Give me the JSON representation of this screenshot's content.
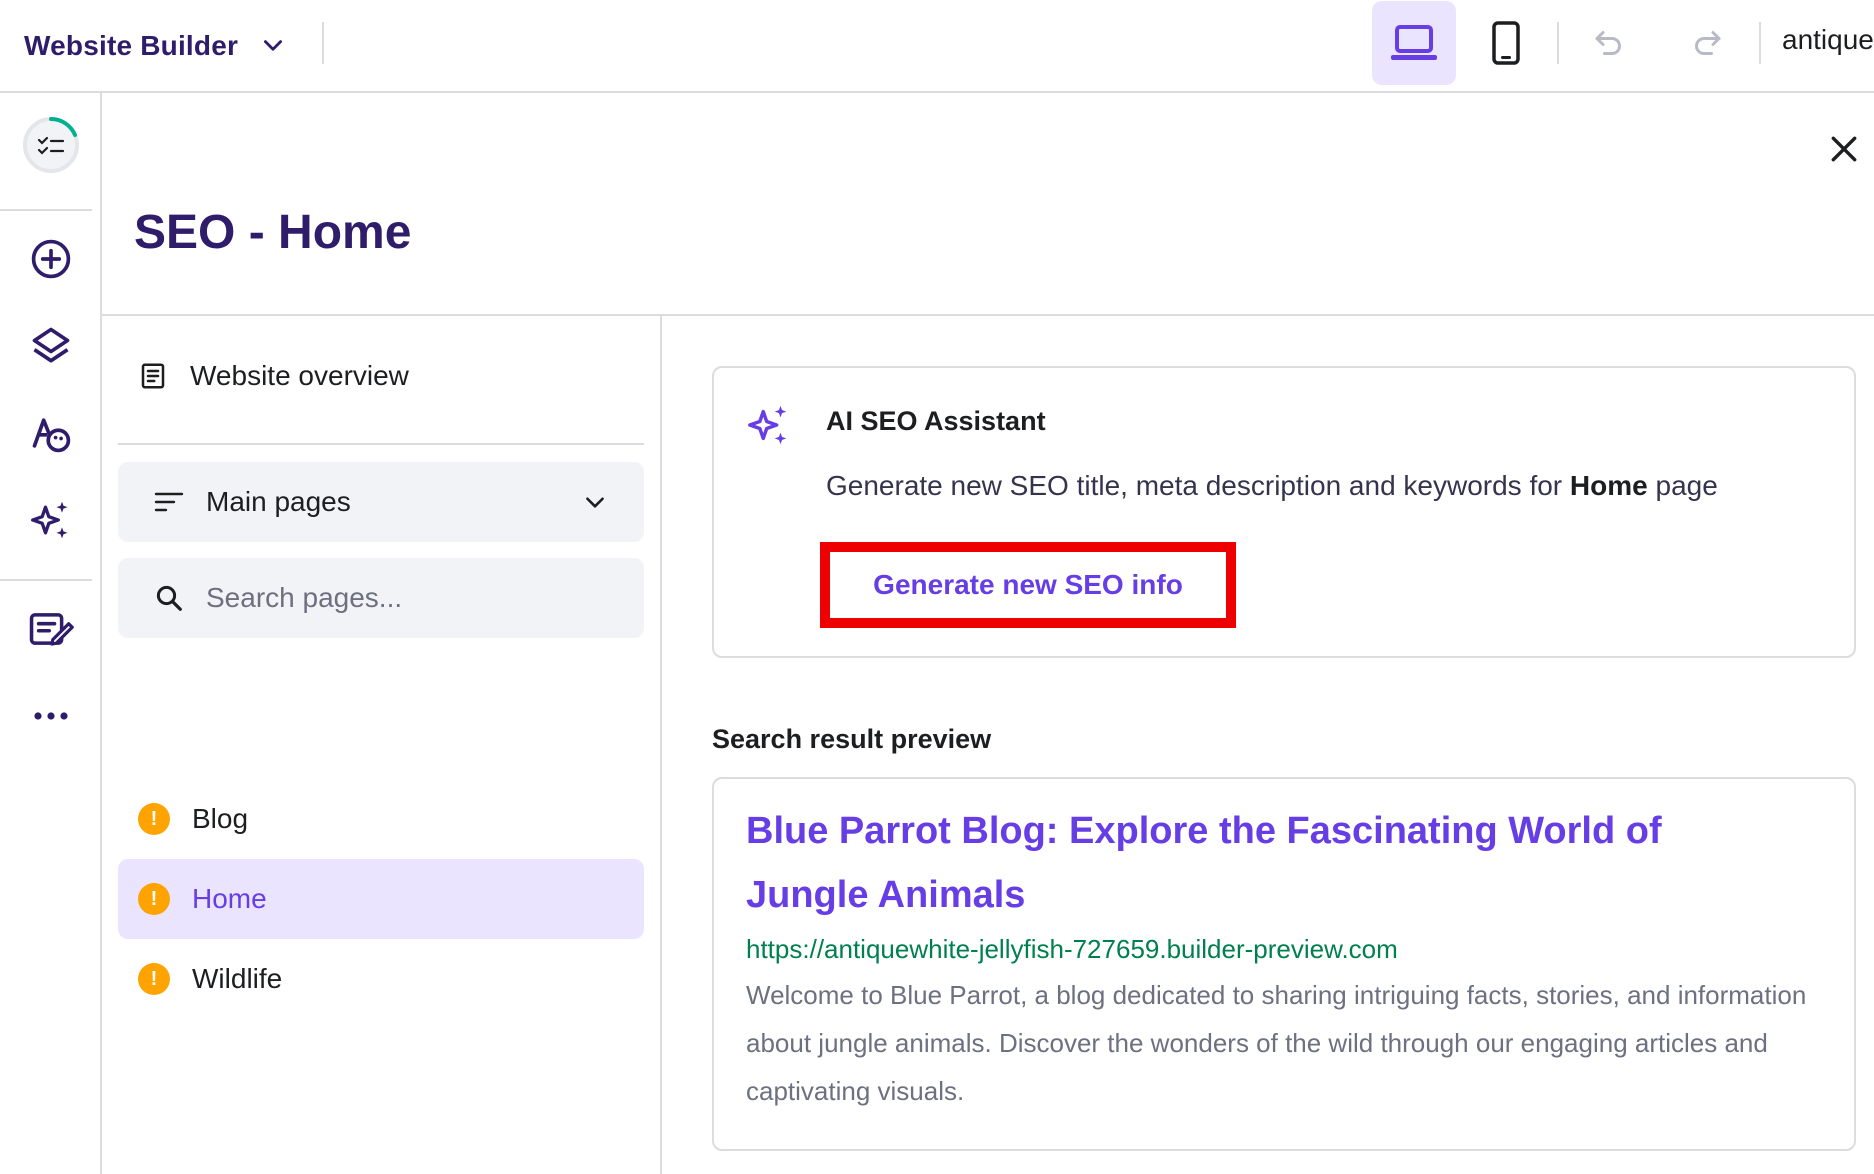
{
  "topbar": {
    "brand_label": "Website Builder",
    "domain_text": "antique",
    "icons": {
      "brand_dropdown": "chevron-down-icon",
      "desktop": "laptop-icon",
      "mobile": "mobile-icon",
      "undo": "undo-icon",
      "redo": "redo-icon"
    },
    "active_device": "desktop"
  },
  "rail": {
    "items": [
      {
        "icon": "checklist-progress-icon"
      },
      {
        "icon": "add-circle-icon"
      },
      {
        "icon": "layers-icon"
      },
      {
        "icon": "styles-palette-icon"
      },
      {
        "icon": "ai-sparkles-icon"
      },
      {
        "icon": "edit-notes-icon"
      },
      {
        "icon": "more-dots-icon"
      }
    ]
  },
  "panel": {
    "title": "SEO - Home"
  },
  "subnav": {
    "overview_label": "Website overview",
    "dropdown_label": "Main pages",
    "search_placeholder": "Search pages...",
    "pages": [
      {
        "label": "Blog",
        "status": "warning",
        "active": false
      },
      {
        "label": "Home",
        "status": "warning",
        "active": true
      },
      {
        "label": "Wildlife",
        "status": "warning",
        "active": false
      }
    ]
  },
  "ai_assistant": {
    "title": "AI SEO Assistant",
    "desc_prefix": "Generate new SEO title, meta description and keywords for ",
    "desc_page": "Home",
    "desc_suffix": " page",
    "button_label": "Generate new SEO info"
  },
  "preview": {
    "heading": "Search result preview",
    "title": "Blue Parrot Blog: Explore the Fascinating World of Jungle Animals",
    "url": "https://antiquewhite-jellyfish-727659.builder-preview.com",
    "description": "Welcome to Blue Parrot, a blog dedicated to sharing intriguing facts, stories, and information about jungle animals. Discover the wonders of the wild through our engaging articles and captivating visuals."
  },
  "colors": {
    "brand_dark": "#2f1c6a",
    "accent": "#673de6",
    "accent_light": "#ebe4ff",
    "warning": "#ffa300",
    "url_green": "#00804f",
    "highlight_red": "#ee0000"
  }
}
